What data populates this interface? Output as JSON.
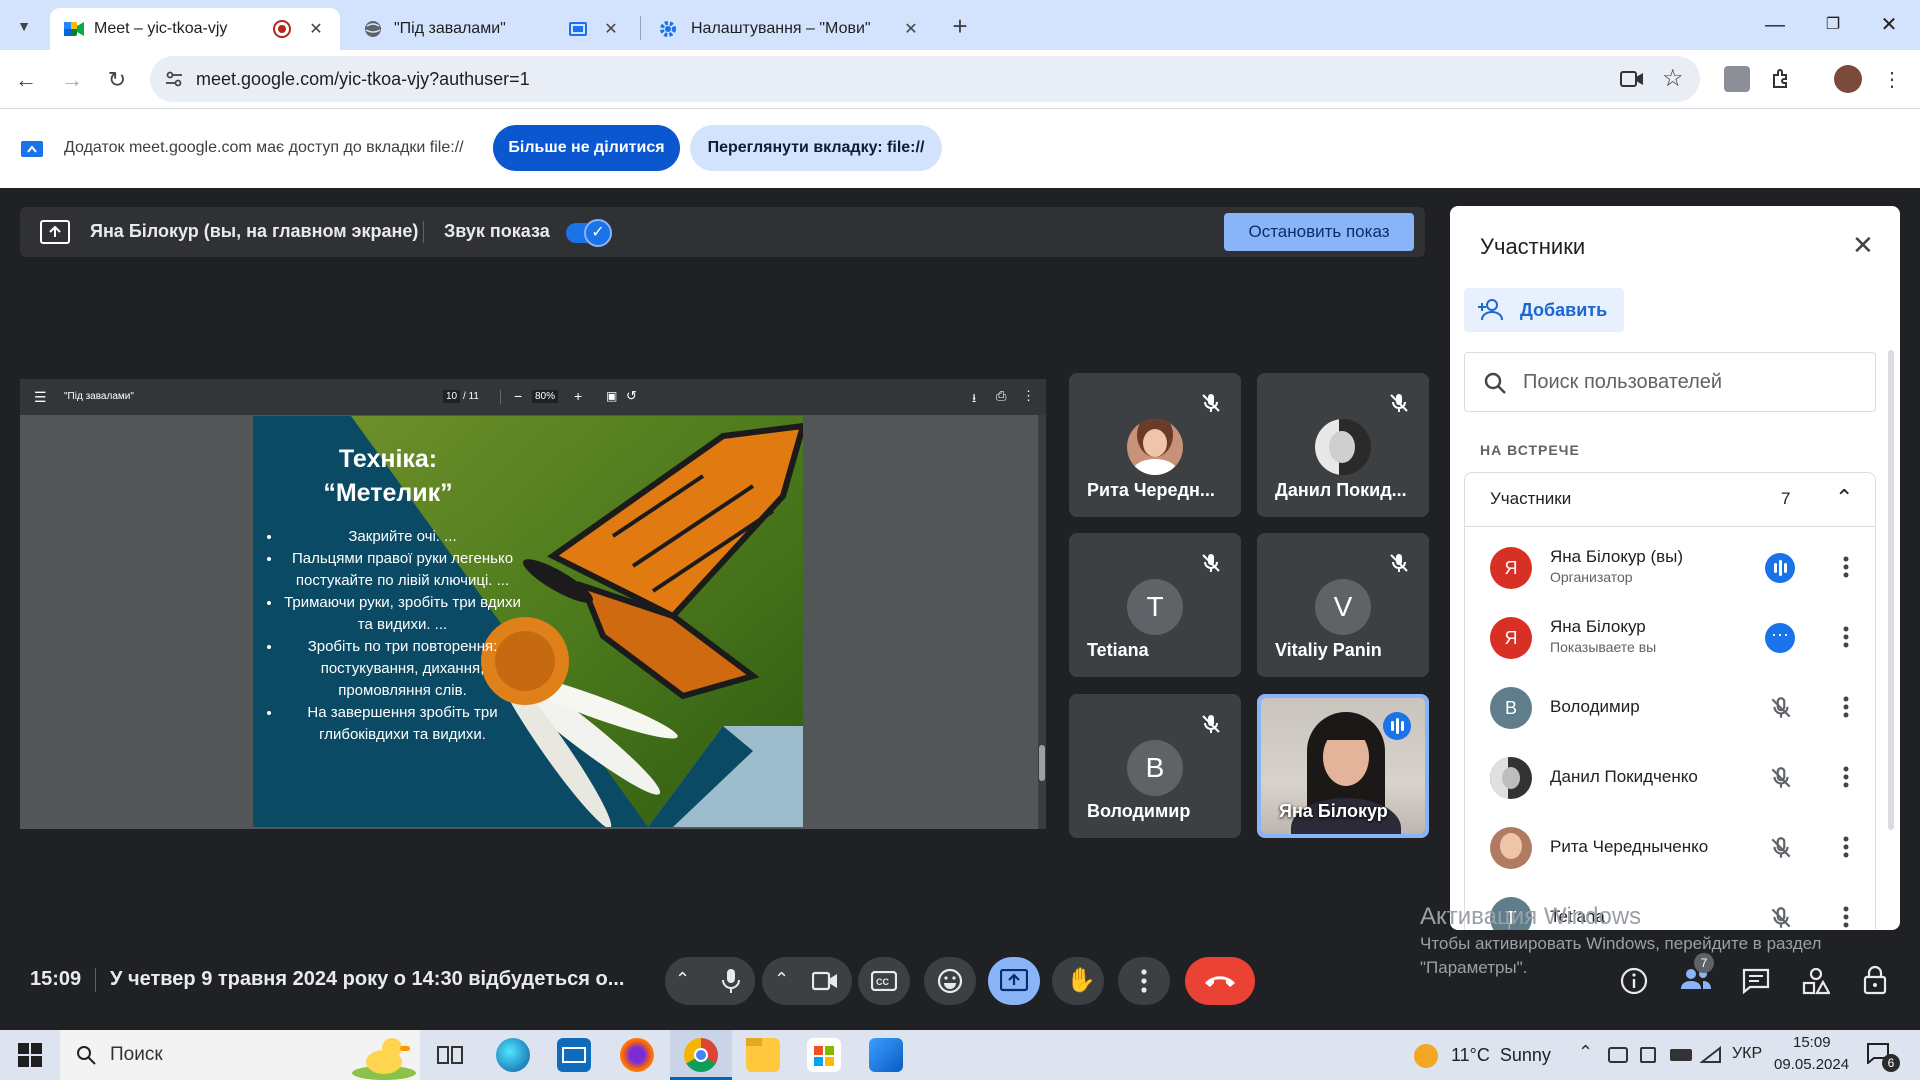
{
  "tabs": [
    {
      "title": "Meet – yic-tkoa-vjy",
      "active": true
    },
    {
      "title": "\"Під завалами\"",
      "active": false
    },
    {
      "title": "Налаштування – \"Мови\"",
      "active": false
    }
  ],
  "address": {
    "url": "meet.google.com/yic-tkoa-vjy?authuser=1"
  },
  "infobar": {
    "message": "Додаток meet.google.com має доступ до вкладки file://",
    "stop_sharing": "Більше не ділитися",
    "view_tab": "Переглянути вкладку: file://"
  },
  "banner": {
    "presenter": "Яна Білокур (вы, на главном экране)",
    "audio_label": "Звук показа",
    "audio_on": true,
    "stop_button": "Остановить показ"
  },
  "pdf_viewer": {
    "title": "\"Під завалами\"",
    "page": "10",
    "pages": "/ 11",
    "zoom": "80%",
    "zoom_out": "−",
    "zoom_in": "+"
  },
  "slide": {
    "title_line1": "Техніка:",
    "title_line2": "“Метелик”",
    "bullets": [
      "Закрийте очі. ...",
      "Пальцями правої руки легенько постукайте по лівій ключиці. ...",
      "Тримаючи руки, зробіть три вдихи та видихи. ...",
      "Зробіть по три повторення: постукування, дихання, промовляння слів.",
      "На завершення зробіть три глибоківдихи та видихи."
    ]
  },
  "tiles": [
    {
      "name": "Рита Чередн...",
      "initial": "",
      "muted": true
    },
    {
      "name": "Данил Покид...",
      "initial": "",
      "muted": true
    },
    {
      "name": "Tetiana",
      "initial": "T",
      "muted": true
    },
    {
      "name": "Vitaliy Panin",
      "initial": "V",
      "muted": true
    },
    {
      "name": "Володимир",
      "initial": "В",
      "muted": true
    },
    {
      "name": "Яна Білокур",
      "initial": "",
      "muted": false,
      "speaking": true
    }
  ],
  "panel": {
    "title": "Участники",
    "add_button": "Добавить",
    "search_placeholder": "Поиск пользователей",
    "section": "НА ВСТРЕЧЕ",
    "group_label": "Участники",
    "group_count": "7",
    "people": [
      {
        "name": "Яна Білокур (вы)",
        "sub": "Организатор",
        "initial": "Я",
        "color": "#d93025",
        "state": "speaking"
      },
      {
        "name": "Яна Білокур",
        "sub": "Показываете вы",
        "initial": "Я",
        "color": "#d93025",
        "state": "more"
      },
      {
        "name": "Володимир",
        "sub": "",
        "initial": "В",
        "color": "#607d8b",
        "state": "muted"
      },
      {
        "name": "Данил Покидченко",
        "sub": "",
        "initial": "",
        "color": "#444444",
        "state": "muted"
      },
      {
        "name": "Рита Чередныченко",
        "sub": "",
        "initial": "",
        "color": "#b07a63",
        "state": "muted"
      },
      {
        "name": "Tetiana",
        "sub": "",
        "initial": "T",
        "color": "#607d8b",
        "state": "muted"
      }
    ]
  },
  "bottom": {
    "time": "15:09",
    "meeting_info": "У четвер 9 травня 2024 року о 14:30 відбудеться о...",
    "people_badge": "7"
  },
  "watermark": {
    "line1": "Активация Windows",
    "line2": "Чтобы активировать Windows, перейдите в раздел",
    "line3": "\"Параметры\"."
  },
  "taskbar": {
    "search": "Поиск",
    "weather": "11°C  Sunny",
    "lang": "УКР",
    "time": "15:09",
    "date": "09.05.2024",
    "notif": "6"
  },
  "colors": {
    "accent": "#0b57d0",
    "meet_blue": "#8ab4f8",
    "end_call": "#ea4335"
  }
}
